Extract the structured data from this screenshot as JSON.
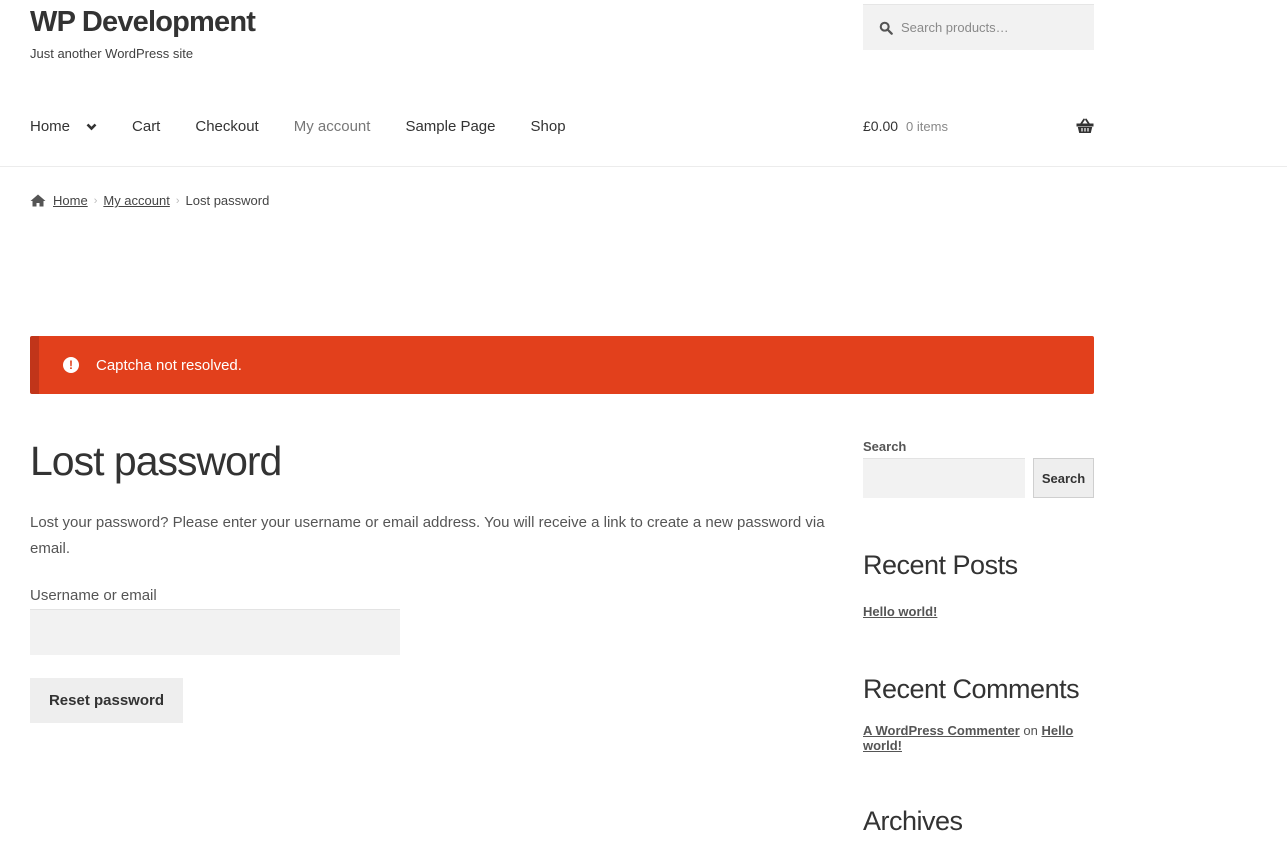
{
  "site": {
    "title": "WP Development",
    "tagline": "Just another WordPress site"
  },
  "header_search": {
    "placeholder": "Search products…",
    "icon": "search-icon"
  },
  "nav": {
    "items": [
      {
        "label": "Home",
        "has_dropdown": true
      },
      {
        "label": "Cart"
      },
      {
        "label": "Checkout"
      },
      {
        "label": "My account",
        "current": true
      },
      {
        "label": "Sample Page"
      },
      {
        "label": "Shop"
      }
    ]
  },
  "cart": {
    "amount": "£0.00",
    "count": "0 items",
    "icon": "basket-icon"
  },
  "breadcrumb": {
    "items": [
      "Home",
      "My account"
    ],
    "current": "Lost password",
    "separator": "›"
  },
  "notice": {
    "icon_glyph": "!",
    "message": "Captcha not resolved.",
    "color": "#e2401c"
  },
  "main": {
    "title": "Lost password",
    "intro": "Lost your password? Please enter your username or email address. You will receive a link to create a new password via email.",
    "field_label": "Username or email",
    "field_value": "",
    "submit_label": "Reset password"
  },
  "sidebar": {
    "search": {
      "label": "Search",
      "value": "",
      "button_label": "Search"
    },
    "recent_posts": {
      "title": "Recent Posts",
      "items": [
        "Hello world!"
      ]
    },
    "recent_comments": {
      "title": "Recent Comments",
      "items": [
        {
          "author": "A WordPress Commenter",
          "connector": "on",
          "post": "Hello world!"
        }
      ]
    },
    "archives": {
      "title": "Archives"
    }
  }
}
